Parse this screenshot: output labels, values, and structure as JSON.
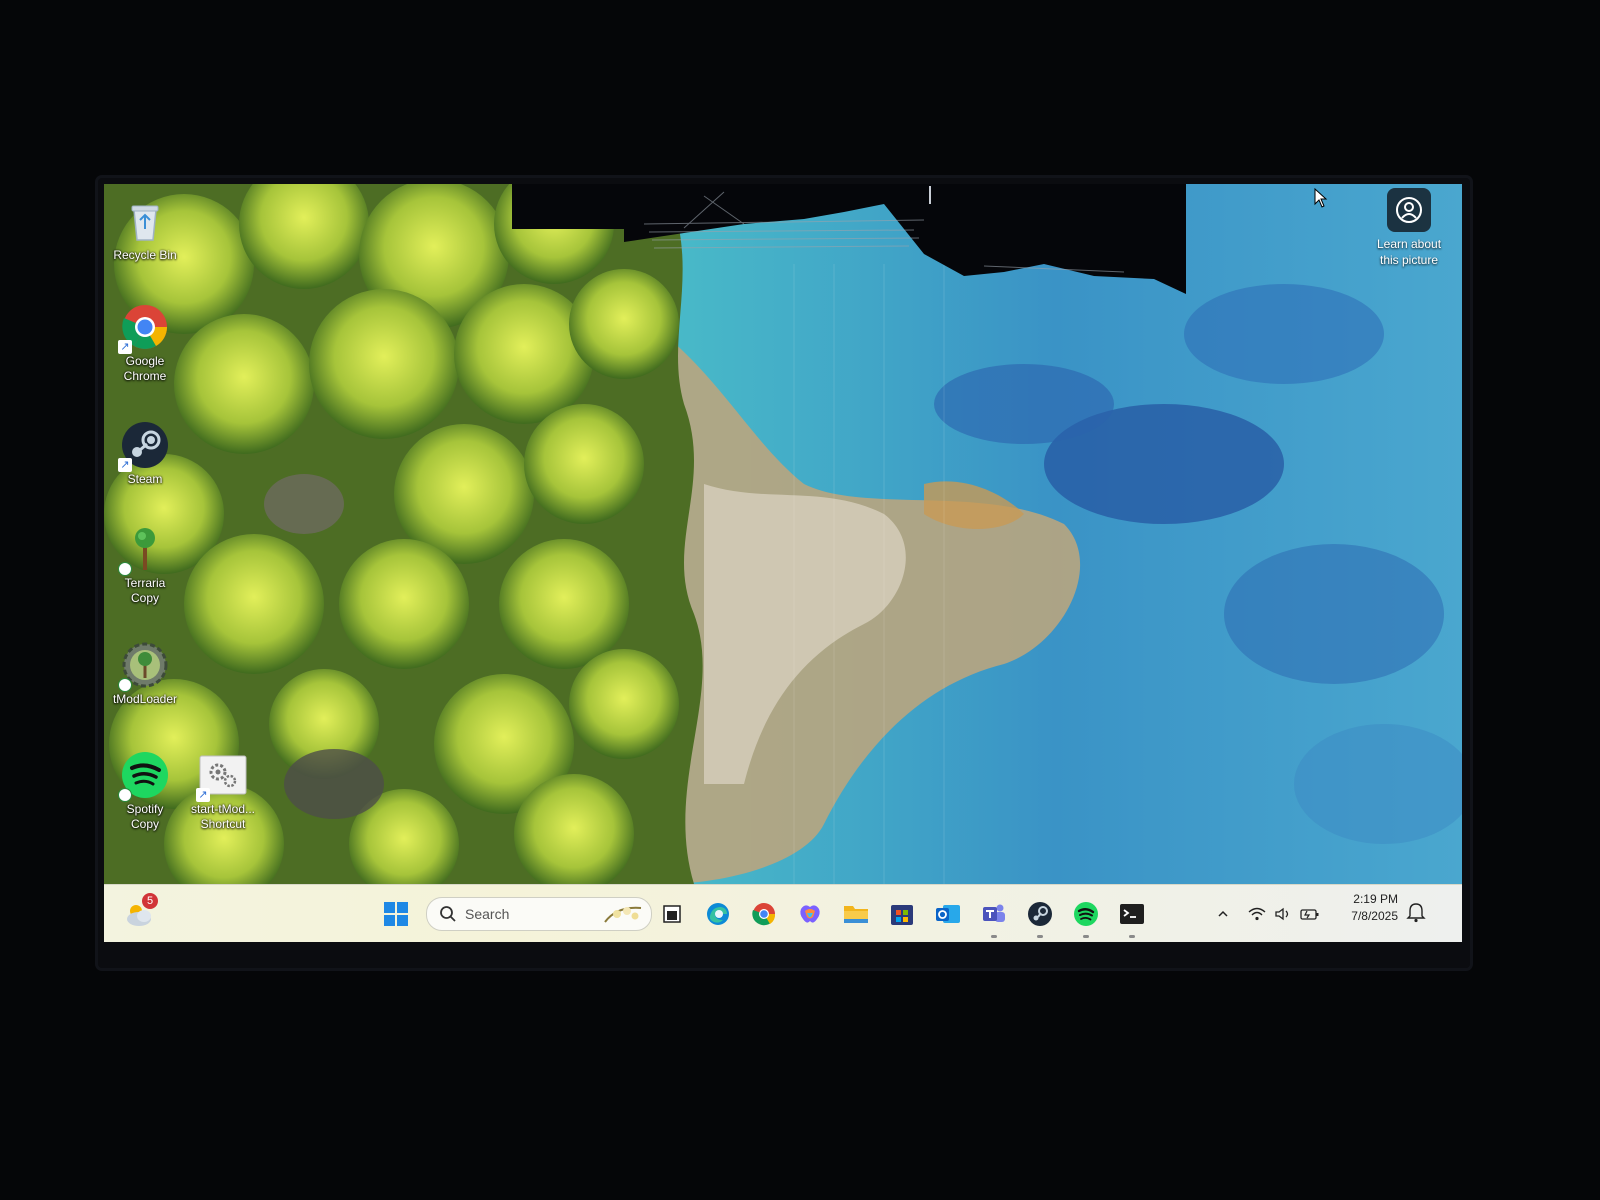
{
  "desktop": {
    "icons": [
      {
        "label_line1": "Recycle Bin",
        "label_line2": "",
        "icon": "recycle-bin-icon"
      },
      {
        "label_line1": "Google",
        "label_line2": "Chrome",
        "icon": "chrome-icon"
      },
      {
        "label_line1": "Steam",
        "label_line2": "",
        "icon": "steam-icon"
      },
      {
        "label_line1": "Terraria",
        "label_line2": "Copy",
        "icon": "terraria-icon"
      },
      {
        "label_line1": "tModLoader",
        "label_line2": "",
        "icon": "tmodloader-icon"
      },
      {
        "label_line1": "Spotify",
        "label_line2": "Copy",
        "icon": "spotify-icon"
      },
      {
        "label_line1": "start-tMod...",
        "label_line2": "Shortcut",
        "icon": "gear-shortcut-icon"
      }
    ],
    "learn_about": {
      "line1": "Learn about",
      "line2": "this picture",
      "icon": "camera-lens-icon"
    }
  },
  "taskbar": {
    "weather": {
      "badge": "5",
      "icon": "weather-cloud-icon"
    },
    "start_icon": "windows-start-icon",
    "search": {
      "placeholder": "Search",
      "icon": "search-icon"
    },
    "apps": [
      {
        "name": "task-view",
        "icon": "task-view-icon"
      },
      {
        "name": "edge",
        "icon": "edge-icon"
      },
      {
        "name": "chrome",
        "icon": "chrome-icon"
      },
      {
        "name": "copilot",
        "icon": "copilot-icon"
      },
      {
        "name": "file-explorer",
        "icon": "folder-icon"
      },
      {
        "name": "microsoft-store",
        "icon": "store-icon"
      },
      {
        "name": "outlook",
        "icon": "outlook-icon"
      },
      {
        "name": "teams",
        "icon": "teams-icon"
      },
      {
        "name": "steam",
        "icon": "steam-icon"
      },
      {
        "name": "spotify",
        "icon": "spotify-icon"
      },
      {
        "name": "terminal",
        "icon": "terminal-icon"
      }
    ],
    "tray": {
      "icons": [
        "chevron-up-icon",
        "wifi-icon",
        "volume-icon",
        "battery-icon"
      ],
      "time": "2:19 PM",
      "date": "7/8/2025",
      "notification_icon": "notification-bell-icon"
    }
  },
  "colors": {
    "forest": "#9cbf2e",
    "water": "#3fb7c9",
    "deep_water": "#2a5fa8",
    "taskbar": "#f3f3df"
  }
}
